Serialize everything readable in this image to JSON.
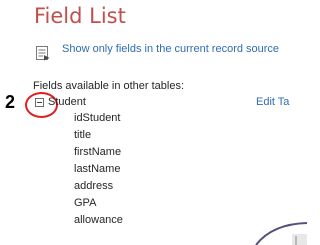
{
  "panel": {
    "title": "Field List",
    "show_only_link": "Show only fields in the current record source",
    "section_label": "Fields available in other tables:",
    "record_icon": "record-source-icon"
  },
  "annotation": {
    "step_number": "2",
    "highlight_color": "#e02020"
  },
  "table": {
    "name": "Student",
    "edit_link": "Edit Ta",
    "toggle_icon": "collapse-minus-icon",
    "fields": [
      "idStudent",
      "title",
      "firstName",
      "lastName",
      "address",
      "GPA",
      "allowance"
    ]
  },
  "colors": {
    "title": "#c0504d",
    "link": "#2e6db4",
    "text": "#262626"
  }
}
